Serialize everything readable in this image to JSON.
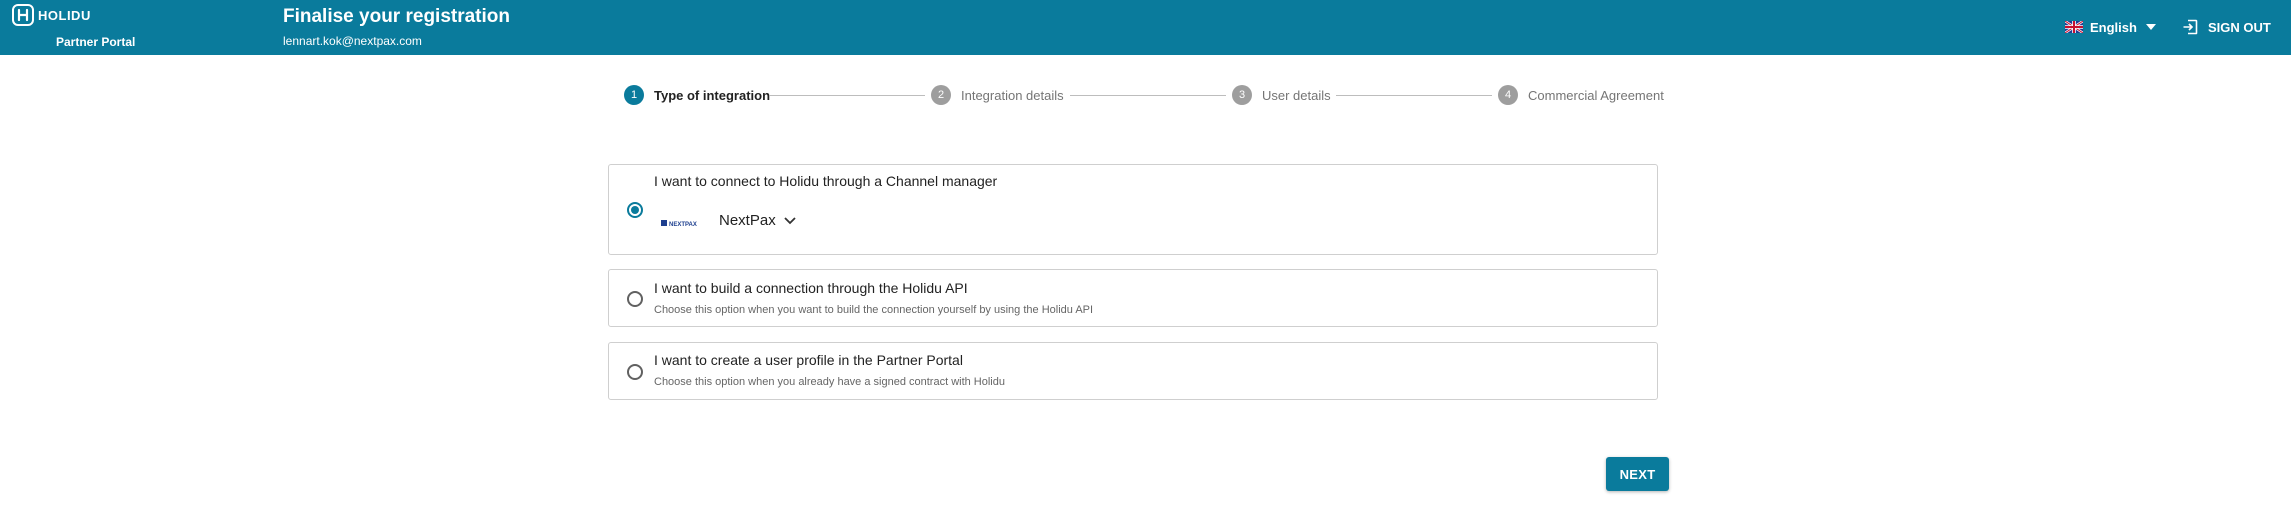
{
  "header": {
    "logo_text": "HOLIDU",
    "portal_label": "Partner Portal",
    "title": "Finalise your registration",
    "email": "lennart.kok@nextpax.com",
    "language": "English",
    "sign_out": "SIGN OUT"
  },
  "stepper": {
    "steps": [
      {
        "number": "1",
        "label": "Type of integration",
        "active": true
      },
      {
        "number": "2",
        "label": "Integration details",
        "active": false
      },
      {
        "number": "3",
        "label": "User details",
        "active": false
      },
      {
        "number": "4",
        "label": "Commercial Agreement",
        "active": false
      }
    ]
  },
  "options": [
    {
      "title": "I want to connect to Holidu through a Channel manager",
      "selected": true,
      "channel_manager": {
        "logo_text": "NEXTPAX",
        "value": "NextPax"
      }
    },
    {
      "title": "I want to build a connection through the Holidu API",
      "description": "Choose this option when you want to build the connection yourself by using the Holidu API",
      "selected": false
    },
    {
      "title": "I want to create a user profile in the Partner Portal",
      "description": "Choose this option when you already have a signed contract with Holidu",
      "selected": false
    }
  ],
  "actions": {
    "next_label": "NEXT"
  },
  "colors": {
    "brand": "#0a7b9c",
    "inactive_step": "#9e9e9e"
  },
  "icons": {
    "logo": "holidu-h-icon",
    "flag": "uk-flag-icon",
    "language_caret": "caret-down-icon",
    "sign_out": "sign-out-icon",
    "select_chevron": "chevron-down-icon"
  }
}
